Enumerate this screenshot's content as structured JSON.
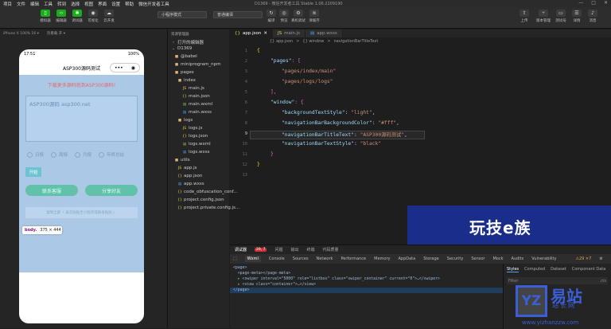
{
  "menu": [
    "项目",
    "文件",
    "编辑",
    "工具",
    "转到",
    "选择",
    "视图",
    "界面",
    "设置",
    "帮助",
    "微信开发者工具"
  ],
  "window_title": "D1369 - 微信开发者工具 Stable 1.06.2209190",
  "window_controls": [
    "—",
    "□",
    "✕"
  ],
  "toolbar": {
    "left": [
      {
        "icon": "phone-icon",
        "label": "模拟器"
      },
      {
        "icon": "code-icon",
        "label": "编辑器"
      },
      {
        "icon": "bug-icon",
        "label": "调试器"
      },
      {
        "icon": "eye-icon",
        "label": "可视化"
      },
      {
        "icon": "cloud-icon",
        "label": "云开发"
      }
    ],
    "mode_select": "小程序模式",
    "compile_select": "普通编译",
    "mid": [
      "编译",
      "预览",
      "真机调试",
      "清缓存"
    ],
    "right": [
      "上传",
      "版本管理",
      "测试号",
      "详情",
      "消息"
    ]
  },
  "subbar": [
    "iPhone X 100% 16 ▾",
    "热重载 开 ▾"
  ],
  "phone": {
    "time": "17:51",
    "battery": "100%",
    "nav_title": "ASP300源码测试",
    "ad_text": "下载更多源码就到ASP300源码!",
    "textarea_value": "ASP300源码 asp300.net",
    "radios": [
      "日报",
      "周报",
      "月报",
      "年终总结"
    ],
    "start_button": "开始",
    "copy_button": "联系客服",
    "share_button": "分享好友",
    "notice": "复制全部（ 再次粘贴至小程序或群发粘贴 ）"
  },
  "body_tag": {
    "tag": "body.",
    "size": "375 × 444"
  },
  "explorer": {
    "title": "资源管理器",
    "open_editors": "打开的编辑器",
    "project": "D1369",
    "items": [
      "@babel",
      "miniprogram_npm",
      "pages",
      "index",
      "main.js",
      "main.json",
      "main.wxml",
      "main.wxss",
      "logs",
      "logs.js",
      "logs.json",
      "logs.wxml",
      "logs.wxss",
      "utils",
      "app.js",
      "app.json",
      "app.wxss",
      "code_obfuscation_conf...",
      "project.config.json",
      "project.private.config.js..."
    ]
  },
  "tabs": [
    "app.json",
    "main.js",
    "app.wxss"
  ],
  "breadcrumb": [
    "{} app.json",
    ">",
    "{} window",
    ">",
    "navigationBarTitleText"
  ],
  "code": {
    "line_numbers": [
      "1",
      "2",
      "3",
      "4",
      "5",
      "6",
      "7",
      "8",
      "9",
      "10",
      "11",
      "12",
      "13"
    ],
    "brace_open": "{",
    "pages_key": "\"pages\"",
    "pages_rest": ": [",
    "page1": "\"pages/index/main\"",
    "page2": "\"pages/logs/logs\"",
    "close_arr": "],",
    "window_key": "\"window\"",
    "window_rest": ": {",
    "k1": "\"backgroundTextStyle\"",
    "v1": "\"light\"",
    "k2": "\"navigationBarBackgroundColor\"",
    "v2": "\"#fff\"",
    "k3": "\"navigationBarTitleText\"",
    "v3": "\"ASP300源码测试\"",
    "k4": "\"navigationBarTextStyle\"",
    "v4": "\"black\"",
    "close_obj": "}",
    "brace_close": "}"
  },
  "banner_text": "玩技e族",
  "devtools": {
    "tabs": [
      "调试器",
      "问题",
      "输出",
      "终端",
      "代码质量"
    ],
    "error_count": "29, 7",
    "subtabs": [
      "Wxml",
      "Console",
      "Sources",
      "Network",
      "Performance",
      "Memory",
      "AppData",
      "Storage",
      "Security",
      "Sensor",
      "Mock",
      "Audits",
      "Vulnerability"
    ],
    "warn": "⚠29 ✕7",
    "lines": [
      "<page>",
      "  <page-meta></page-meta>",
      "  ▸ <swiper interval=\"5000\" role=\"listbox\" class=\"swiper_container\" current=\"0\">…</swiper>",
      "  ▸ <view class=\"container\">…</view>",
      "</page>"
    ],
    "style_tabs": [
      "Styles",
      "Computed",
      "Dataset",
      "Component Data"
    ],
    "filter": "Filter",
    "cls": ".cls"
  },
  "watermark": {
    "box": "YZ",
    "name": "易站",
    "sub": "站长网",
    "url": "www.yizhanzzw.com"
  }
}
